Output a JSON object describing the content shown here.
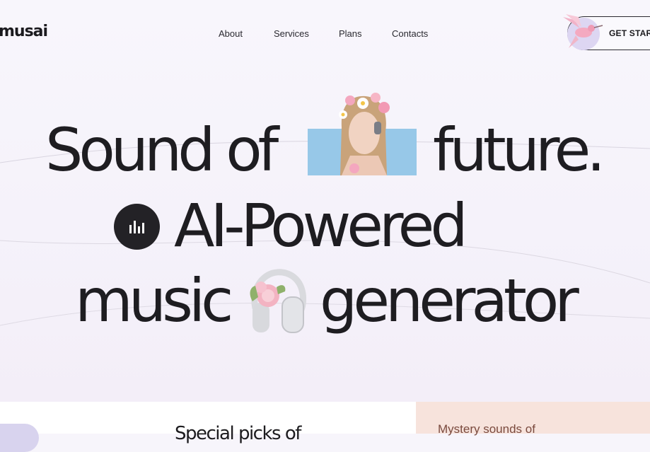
{
  "header": {
    "logo": "musai",
    "nav": [
      "About",
      "Services",
      "Plans",
      "Contacts"
    ],
    "cta_label": "GET STAR"
  },
  "hero": {
    "line1_a": "Sound of",
    "line1_b": "future.",
    "line2": "AI-Powered",
    "line3_a": "music",
    "line3_b": "generator",
    "photo_bg_color": "#97c8e8",
    "badge_icon": "equalizer-bars-icon",
    "headphones_icon": "flower-headphones-icon"
  },
  "sections": {
    "special_heading": "Special picks of",
    "mystery_heading": "Mystery sounds of"
  },
  "colors": {
    "text": "#1e1d21",
    "background": "#f7f5fb",
    "mystery_card": "#f7e3dc",
    "pill": "#d8d3ee"
  }
}
